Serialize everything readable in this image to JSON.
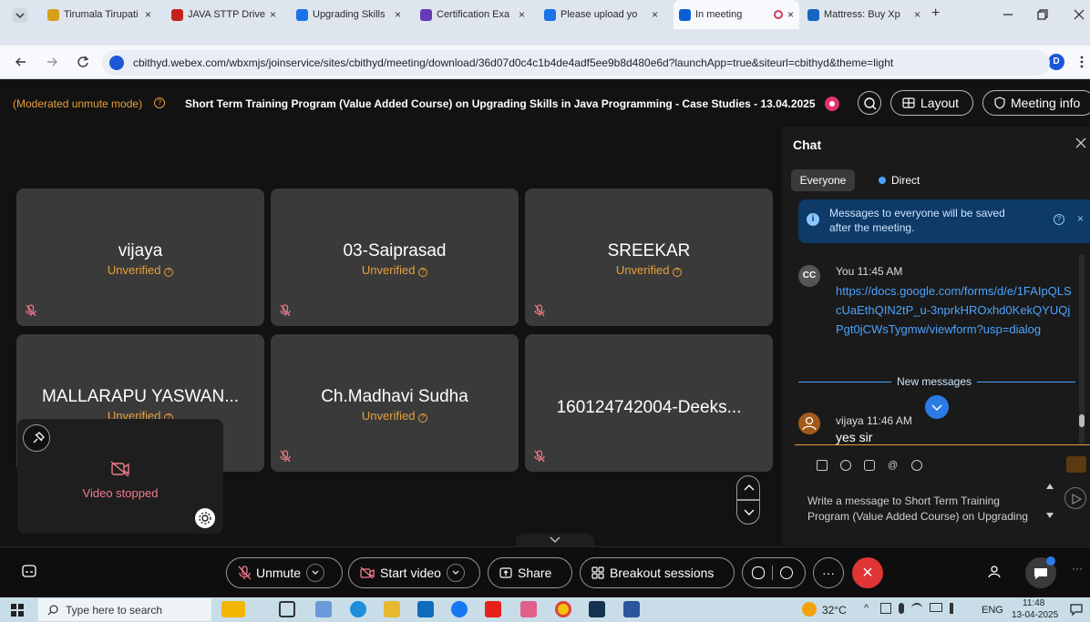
{
  "browser": {
    "tabs": [
      {
        "label": "Tirumala Tirupati",
        "color": "#d4a017"
      },
      {
        "label": "JAVA STTP Drive",
        "color": "#c5221f"
      },
      {
        "label": "Upgrading Skills",
        "color": "#1a73e8"
      },
      {
        "label": "Certification Exa",
        "color": "#673ab7"
      },
      {
        "label": "Please upload yo",
        "color": "#1a73e8"
      },
      {
        "label": "In meeting",
        "color": "#0a60d6"
      },
      {
        "label": "Mattress: Buy Xp",
        "color": "#1565c0"
      }
    ],
    "tab_close": "×",
    "new_tab": "+",
    "url": "cbithyd.webex.com/wbxmjs/joinservice/sites/cbithyd/meeting/download/36d07d0c4c1b4de4adf5ee9b8d480e6d?launchApp=true&siteurl=cbithyd&theme=light",
    "profile_initial": "D"
  },
  "meeting": {
    "mode": "(Moderated unmute mode)",
    "title": "Short Term Training Program (Value Added Course) on Upgrading Skills in Java Programming - Case Studies - 13.04.2025",
    "layout_label": "Layout",
    "info_label": "Meeting info"
  },
  "participants": [
    {
      "name": "vijaya",
      "status": "Unverified"
    },
    {
      "name": "03-Saiprasad",
      "status": "Unverified"
    },
    {
      "name": "SREEKAR",
      "status": "Unverified"
    },
    {
      "name": "MALLARAPU YASWAN...",
      "status": "Unverified"
    },
    {
      "name": "Ch.Madhavi Sudha",
      "status": "Unverified"
    },
    {
      "name": "160124742004-Deeks...",
      "status": ""
    }
  ],
  "self_view": {
    "status": "Video stopped"
  },
  "chat": {
    "title": "Chat",
    "tab_everyone": "Everyone",
    "tab_direct": "Direct",
    "notice": "Messages to everyone will be saved after the meeting.",
    "msg1": {
      "initials": "CC",
      "author": "You",
      "time": "11:45 AM",
      "link": "https://docs.google.com/forms/d/e/1FAIpQLScUaEthQIN2tP_u-3nprkHROxhd0KekQYUQjPgt0jCWsTygmw/viewform?usp=dialog"
    },
    "divider": "New messages",
    "msg2": {
      "author": "vijaya",
      "time": "11:46 AM",
      "text": "yes sir"
    },
    "input_placeholder": "Write a message to Short Term Training Program (Value Added Course) on Upgrading"
  },
  "controls": {
    "unmute": "Unmute",
    "start_video": "Start video",
    "share": "Share",
    "breakout": "Breakout sessions",
    "more": "···",
    "end": "×"
  },
  "taskbar": {
    "search_placeholder": "Type here to search",
    "temp": "32°C",
    "lang": "ENG",
    "time": "11:48",
    "date": "13-04-2025"
  },
  "colors": {
    "accent": "#e8a03a",
    "end_red": "#e03535",
    "link": "#4aa3ff",
    "chat_bg": "#1a1a1a"
  }
}
